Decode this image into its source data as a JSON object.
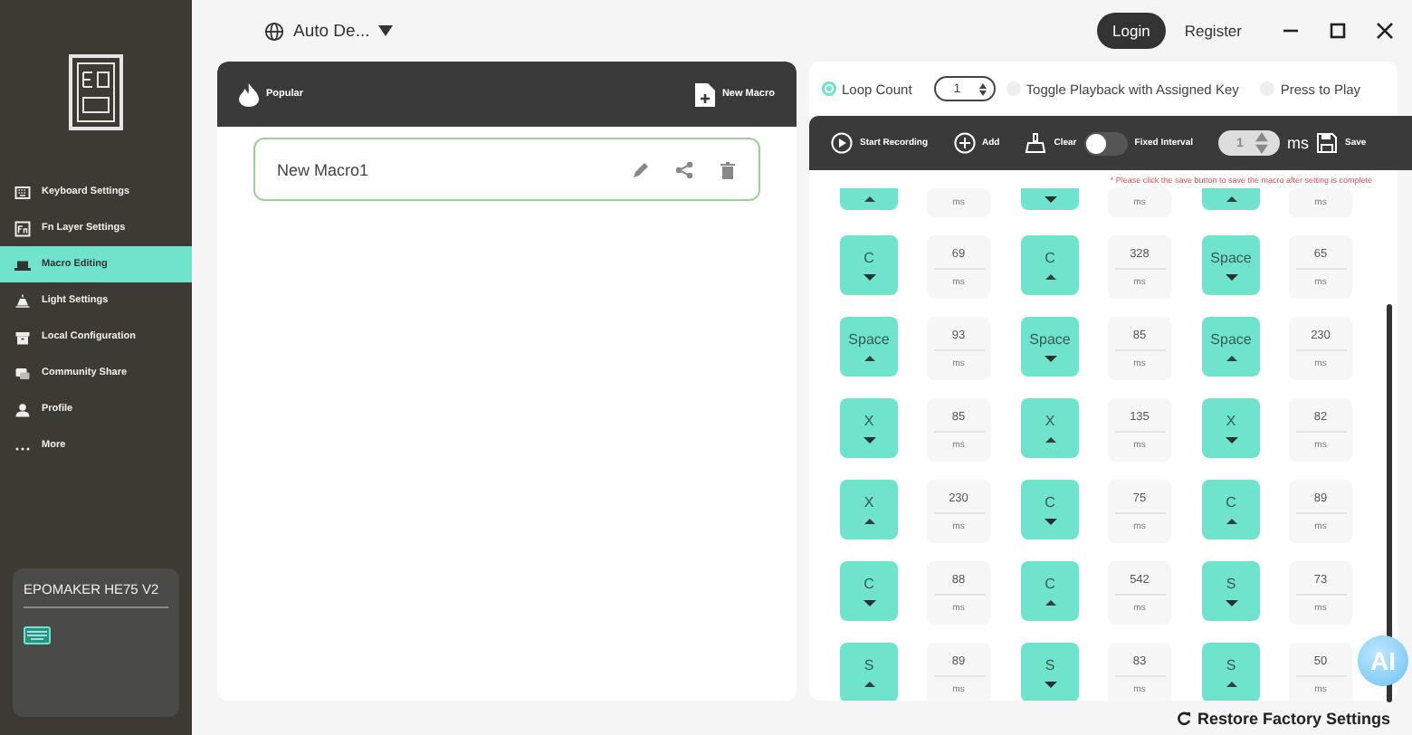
{
  "sidebar": {
    "items": [
      {
        "label": "Keyboard Settings",
        "selected": false
      },
      {
        "label": "Fn Layer Settings",
        "selected": false
      },
      {
        "label": "Macro Editing",
        "selected": true
      },
      {
        "label": "Light Settings",
        "selected": false
      },
      {
        "label": "Local Configuration",
        "selected": false
      },
      {
        "label": "Community Share",
        "selected": false
      },
      {
        "label": "Profile",
        "selected": false
      },
      {
        "label": "More",
        "selected": false
      }
    ],
    "device": {
      "name": "EPOMAKER HE75 V2"
    }
  },
  "topbar": {
    "language": "Auto De...",
    "login": "Login",
    "register": "Register"
  },
  "macro_list": {
    "popular": "Popular",
    "new_macro": "New Macro",
    "macros": [
      {
        "name": "New Macro1",
        "selected": true
      }
    ]
  },
  "editor": {
    "modes": [
      {
        "label": "Loop Count",
        "selected": true
      },
      {
        "label": "Toggle Playback with Assigned Key",
        "selected": false
      },
      {
        "label": "Press to Play",
        "selected": false
      }
    ],
    "loop_count": "1",
    "toolbar": {
      "record": "Start Recording",
      "add": "Add",
      "clear": "Clear",
      "fixed_interval": {
        "label": "Fixed Interval",
        "on": false
      },
      "interval": "1",
      "unit": "ms",
      "save": "Save"
    },
    "warning": "* Please click the save button to save the macro after setting is complete",
    "rows": [
      [
        {
          "pressed": false,
          "unit": "ms"
        },
        {
          "pressed": true,
          "unit": "ms"
        },
        {
          "pressed": false,
          "unit": "ms"
        }
      ],
      [
        {
          "key": "C",
          "pressed": true,
          "delay": "69",
          "unit": "ms"
        },
        {
          "key": "C",
          "pressed": false,
          "delay": "328",
          "unit": "ms"
        },
        {
          "key": "Space",
          "pressed": true,
          "delay": "65",
          "unit": "ms"
        }
      ],
      [
        {
          "key": "Space",
          "pressed": false,
          "delay": "93",
          "unit": "ms"
        },
        {
          "key": "Space",
          "pressed": true,
          "delay": "85",
          "unit": "ms"
        },
        {
          "key": "Space",
          "pressed": false,
          "delay": "230",
          "unit": "ms"
        }
      ],
      [
        {
          "key": "X",
          "pressed": true,
          "delay": "85",
          "unit": "ms"
        },
        {
          "key": "X",
          "pressed": false,
          "delay": "135",
          "unit": "ms"
        },
        {
          "key": "X",
          "pressed": true,
          "delay": "82",
          "unit": "ms"
        }
      ],
      [
        {
          "key": "X",
          "pressed": false,
          "delay": "230",
          "unit": "ms"
        },
        {
          "key": "C",
          "pressed": true,
          "delay": "75",
          "unit": "ms"
        },
        {
          "key": "C",
          "pressed": false,
          "delay": "89",
          "unit": "ms"
        }
      ],
      [
        {
          "key": "C",
          "pressed": true,
          "delay": "88",
          "unit": "ms"
        },
        {
          "key": "C",
          "pressed": false,
          "delay": "542",
          "unit": "ms"
        },
        {
          "key": "S",
          "pressed": true,
          "delay": "73",
          "unit": "ms"
        }
      ],
      [
        {
          "key": "S",
          "pressed": false,
          "delay": "89",
          "unit": "ms"
        },
        {
          "key": "S",
          "pressed": true,
          "delay": "83",
          "unit": "ms"
        },
        {
          "key": "S",
          "pressed": false,
          "delay": "50",
          "unit": "ms"
        }
      ]
    ],
    "restore": "Restore Factory Settings"
  },
  "assistant": {
    "label": "AI"
  }
}
